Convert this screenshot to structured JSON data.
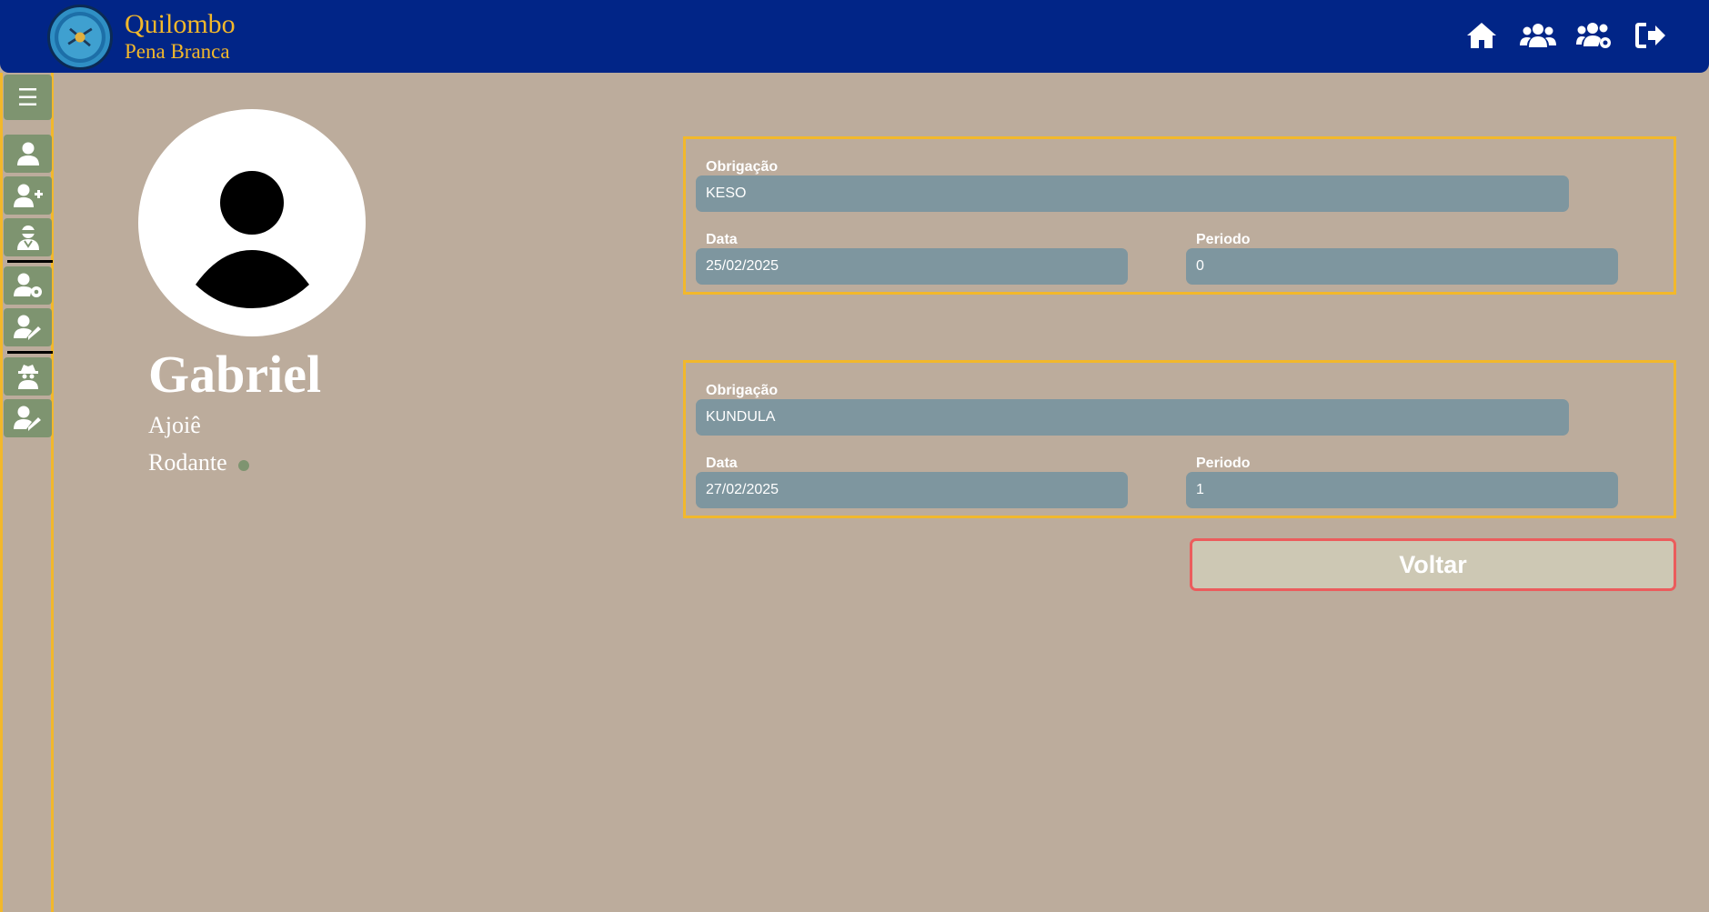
{
  "header": {
    "brand_title": "Quilombo",
    "brand_subtitle": "Pena Branca",
    "nav_icons": [
      "home-icon",
      "users-icon",
      "users-cog-icon",
      "sign-out-icon"
    ]
  },
  "sidebar": {
    "menu_glyph": "☰",
    "items": [
      "user-icon",
      "user-plus-icon",
      "user-ninja-icon",
      "user-cog-icon",
      "user-edit-icon",
      "user-secret-icon",
      "user-edit-icon"
    ]
  },
  "profile": {
    "name": "Gabriel",
    "role": "Ajoiê",
    "status": "Rodante",
    "status_color": "#7e9470"
  },
  "obligations": [
    {
      "obrigacao_label": "Obrigação",
      "obrigacao": "KESO",
      "data_label": "Data",
      "data": "25/02/2025",
      "periodo_label": "Periodo",
      "periodo": "0"
    },
    {
      "obrigacao_label": "Obrigação",
      "obrigacao": "KUNDULA",
      "data_label": "Data",
      "data": "27/02/2025",
      "periodo_label": "Periodo",
      "periodo": "1"
    }
  ],
  "actions": {
    "back_label": "Voltar"
  },
  "colors": {
    "header_bg": "#012587",
    "accent": "#f2b82b",
    "page_bg": "#bcac9c",
    "sidebar_button": "#7e9470",
    "field_bg": "#7e969f",
    "back_border": "#eb5c5c"
  }
}
